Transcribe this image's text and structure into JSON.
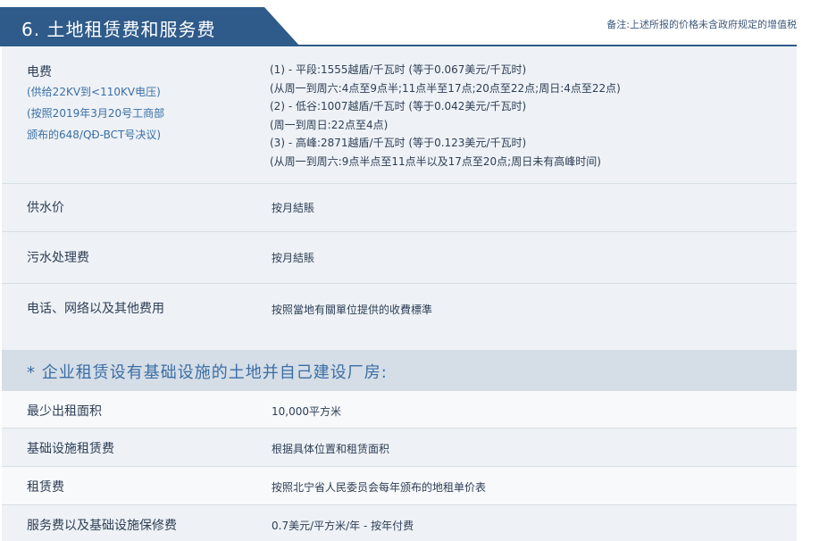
{
  "header": {
    "title": "6. 土地租赁费和服务费",
    "note": "备注:上述所报的价格未含政府规定的增值税"
  },
  "electricity": {
    "label": "电费",
    "sub1": "(供给22KV到<110KV电压)",
    "sub2": "(按照2019年3月20号工商部",
    "sub3": "颁布的648/QĐ-BCT号决议)",
    "lines": [
      "(1) - 平段:1555越盾/千瓦时 (等于0.067美元/千瓦时)",
      "(从周一到周六:4点至9点半;11点半至17点;20点至22点;周日:4点至22点)",
      "(2) - 低谷:1007越盾/千瓦时 (等于0.042美元/千瓦时)",
      "(周一到周日:22点至4点)",
      "(3) - 高峰:2871越盾/千瓦时 (等于0.123美元/千瓦时)",
      "(从周一到周六:9点半点至11点半以及17点至20点;周日未有高峰时间)"
    ]
  },
  "rows": [
    {
      "label": "供水价",
      "value": "按月結賬"
    },
    {
      "label": "污水处理费",
      "value": "按月結賬"
    },
    {
      "label": "电话、网络以及其他费用",
      "value": "按照當地有關單位提供的收費標準"
    }
  ],
  "section": {
    "title": "* 企业租赁设有基础设施的土地并自己建设厂房:"
  },
  "rows2": [
    {
      "label": "最少出租面积",
      "value": "10,000平方米"
    },
    {
      "label": "基础设施租赁费",
      "value": "根据具体位置和租赁面积"
    },
    {
      "label": "租赁费",
      "value": "按照北宁省人民委员会每年颁布的地租单价表"
    },
    {
      "label": "服务费以及基础设施保修费",
      "value": "0.7美元/平方米/年 - 按年付费"
    }
  ]
}
